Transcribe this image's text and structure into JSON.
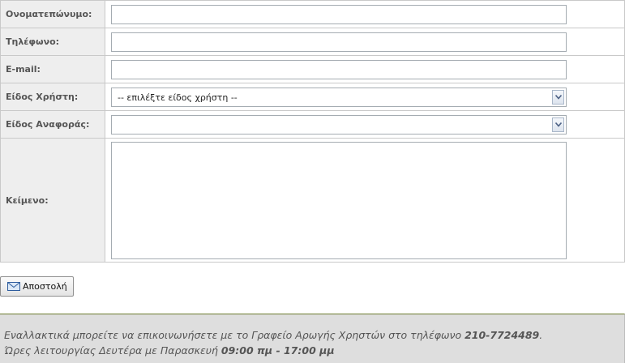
{
  "form": {
    "name_label": "Ονοματεπώνυμο:",
    "name_value": "",
    "phone_label": "Τηλέφωνο:",
    "phone_value": "",
    "email_label": "E-mail:",
    "email_value": "",
    "user_type_label": "Είδος Χρήστη:",
    "user_type_selected": "-- επιλέξτε είδος χρήστη --",
    "report_type_label": "Είδος Αναφοράς:",
    "report_type_selected": "",
    "text_label": "Κείμενο:",
    "text_value": ""
  },
  "send_button": {
    "label": "Αποστολή",
    "icon": "envelope-icon"
  },
  "info": {
    "line1_text": "Εναλλακτικά μπορείτε να επικοινωνήσετε με το Γραφείο Αρωγής Χρηστών στο τηλέφωνο ",
    "phone": "210-7724489",
    "line1_end": ".",
    "line2_text": "Ώρες λειτουργίας Δευτέρα με Παρασκευή ",
    "hours": "09:00 πμ - 17:00 μμ"
  },
  "colors": {
    "label_bg": "#eeeeee",
    "label_text": "#555555",
    "info_bg": "#dedede",
    "info_border": "#6c7a2c"
  }
}
